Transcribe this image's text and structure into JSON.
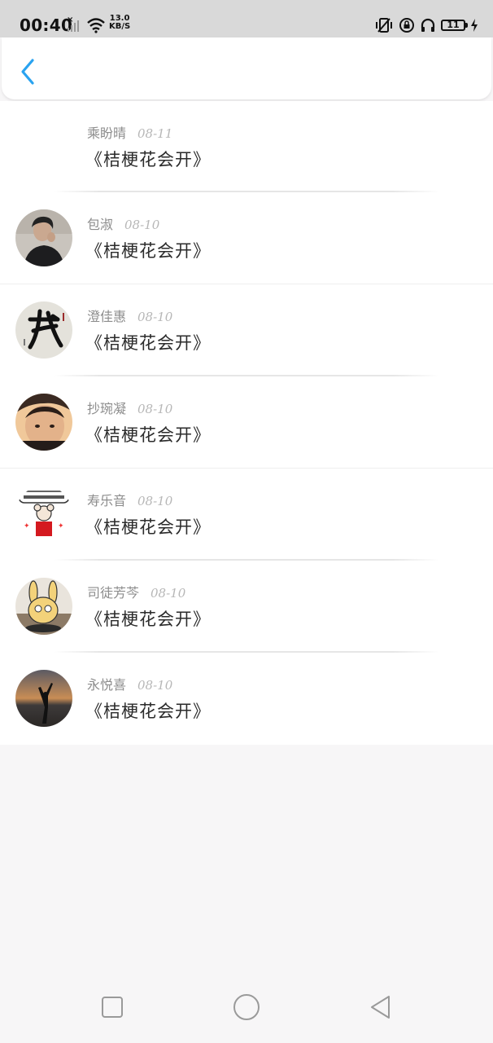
{
  "status": {
    "time": "00:40",
    "speed_value": "13.0",
    "speed_unit": "KB/S",
    "battery": "11"
  },
  "header": {
    "back_icon": "chevron-left-icon",
    "accent": "#2aa3f0"
  },
  "items": [
    {
      "name": "乘盼晴",
      "date": "08-11",
      "title": "《桔梗花会开》",
      "avatar": "none"
    },
    {
      "name": "包淑",
      "date": "08-10",
      "title": "《桔梗花会开》",
      "avatar": "photo-man"
    },
    {
      "name": "澄佳惠",
      "date": "08-10",
      "title": "《桔梗花会开》",
      "avatar": "calligraphy"
    },
    {
      "name": "抄琬凝",
      "date": "08-10",
      "title": "《桔梗花会开》",
      "avatar": "photo-face"
    },
    {
      "name": "寿乐音",
      "date": "08-10",
      "title": "《桔梗花会开》",
      "avatar": "sticker-rat"
    },
    {
      "name": "司徒芳芩",
      "date": "08-10",
      "title": "《桔梗花会开》",
      "avatar": "cartoon-rabbit"
    },
    {
      "name": "永悦喜",
      "date": "08-10",
      "title": "《桔梗花会开》",
      "avatar": "sunset-silhouette"
    }
  ],
  "nav": {
    "recents_icon": "square-icon",
    "home_icon": "circle-icon",
    "back_icon": "triangle-back-icon"
  }
}
